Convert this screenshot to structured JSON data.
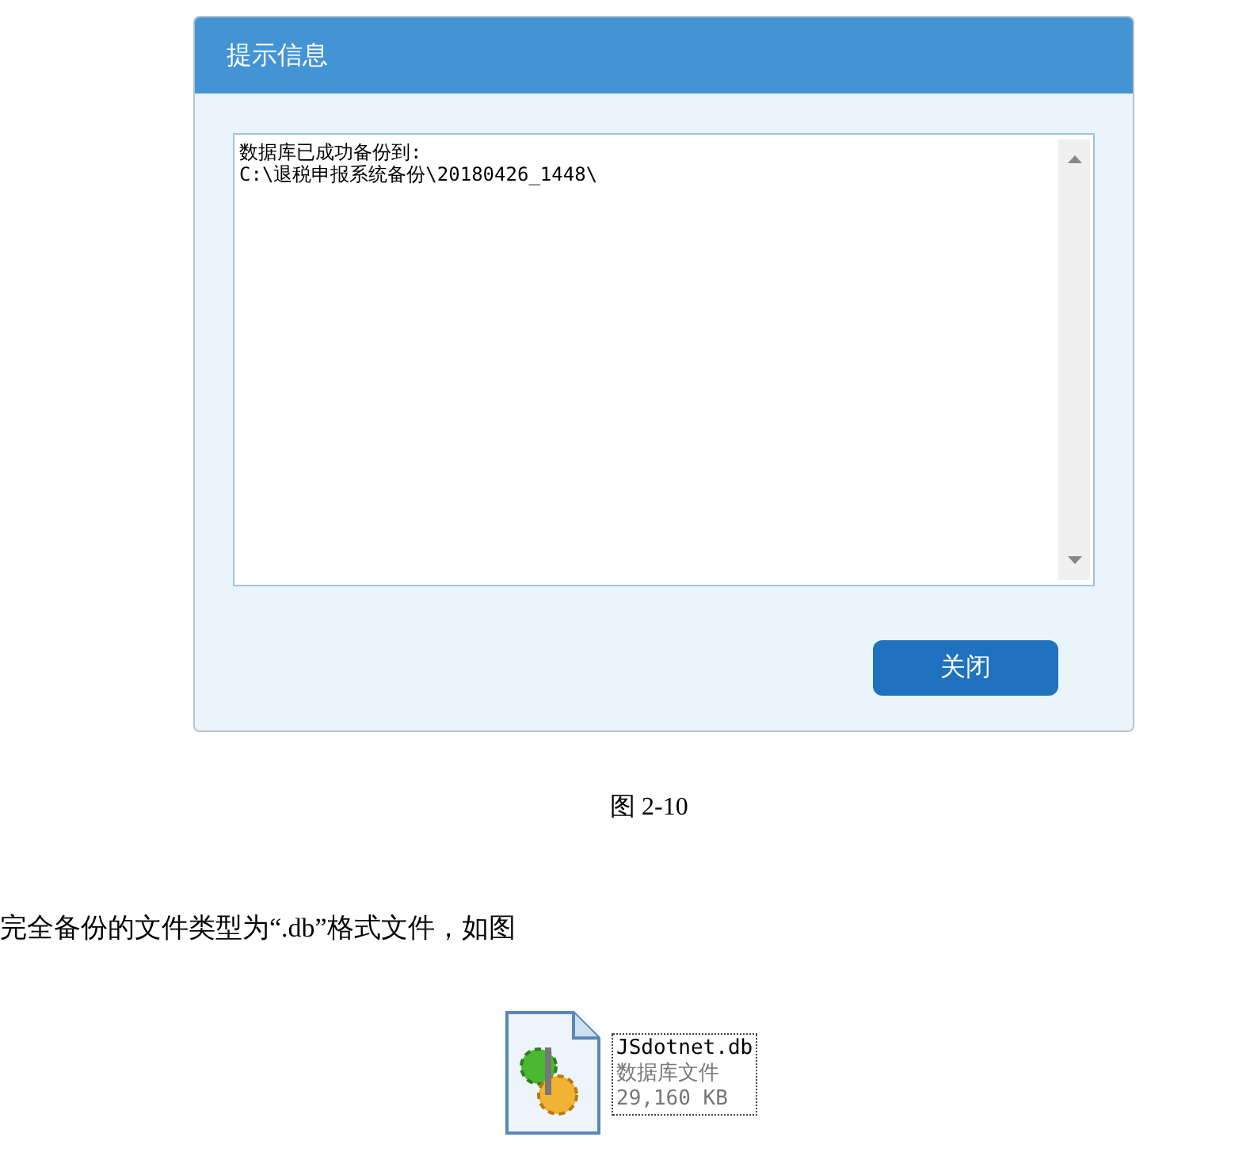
{
  "dialog": {
    "title": "提示信息",
    "message": [
      "数据库已成功备份到:",
      "C:\\退税申报系统备份\\20180426_1448\\"
    ],
    "button": "关闭"
  },
  "caption": "图 2-10",
  "paragraph": "完全备份的文件类型为“.db”格式文件，如图",
  "file": {
    "name": "JSdotnet.db",
    "type": "数据库文件",
    "size": "29,160 KB"
  }
}
